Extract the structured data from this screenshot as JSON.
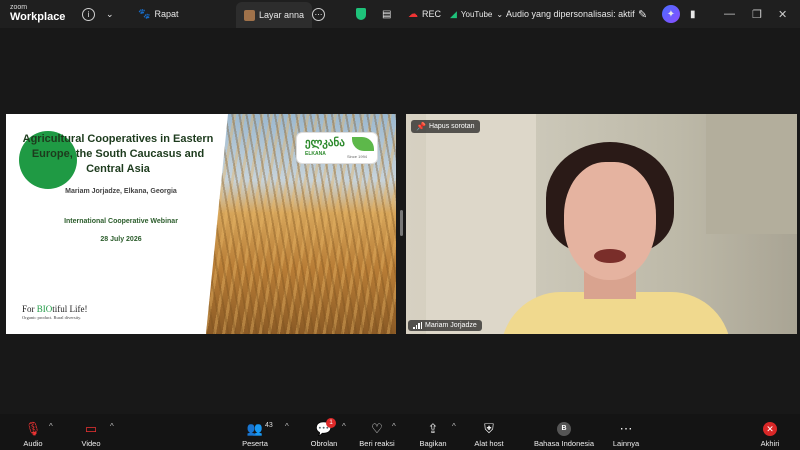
{
  "app": {
    "brand_top": "zoom",
    "brand_bottom": "Workplace"
  },
  "topbar": {
    "meeting_label": "Rapat",
    "share_tab_label": "Layar anna",
    "rec_label": "REC",
    "youtube_label": "YouTube",
    "audio_label": "Audio yang dipersonalisasi: aktif"
  },
  "slide": {
    "title": "Agricultural Cooperatives in Eastern Europe, the South Caucasus and Central Asia",
    "author": "Mariam Jorjadze, Elkana, Georgia",
    "webinar": "International Cooperative Webinar",
    "date": "28 July 2026",
    "footer_pre": "For ",
    "footer_bio": "BIO",
    "footer_post": "tiful Life!",
    "footer_sub": "Organic product. Rural diversity.",
    "logo_text": "ელკანა",
    "logo_sub": "ELKANA",
    "logo_since": "Since 1994"
  },
  "video": {
    "unpin_label": "Hapus sorotan",
    "participant_name": "Mariam Jorjadze"
  },
  "toolbar": {
    "audio": "Audio",
    "video": "Video",
    "participants": "Peserta",
    "participants_count": "43",
    "chat": "Obrolan",
    "chat_badge": "1",
    "react": "Beri reaksi",
    "share": "Bagikan",
    "host_tools": "Alat host",
    "language": "Bahasa Indonesia",
    "language_initial": "B",
    "more": "Lainnya",
    "end": "Akhiri"
  },
  "colors": {
    "end_red": "#d92727",
    "shield_green": "#1ec27a",
    "slide_green": "#1f9a44"
  }
}
